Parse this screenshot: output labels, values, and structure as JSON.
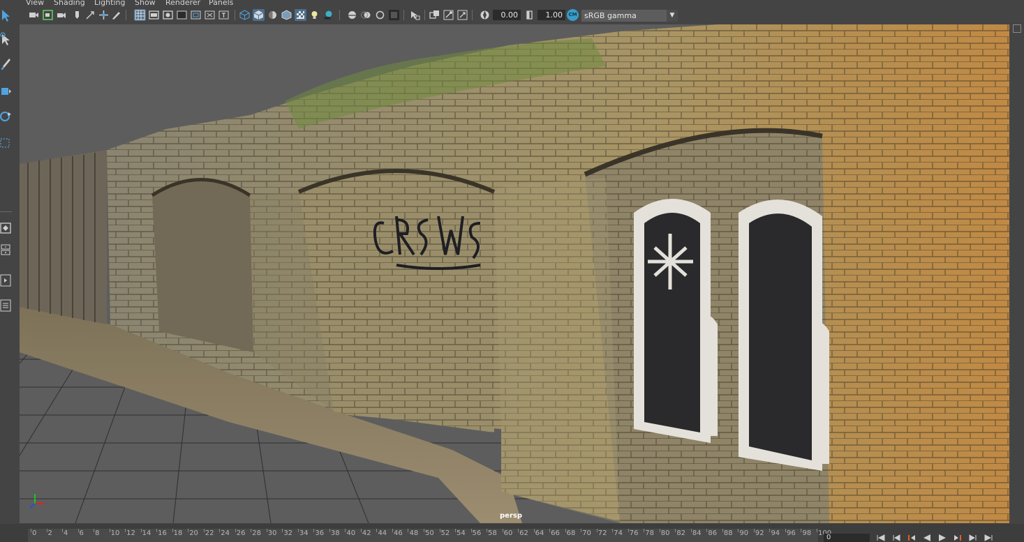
{
  "menu": [
    {
      "id": "view",
      "label": "View"
    },
    {
      "id": "shading",
      "label": "Shading"
    },
    {
      "id": "lighting",
      "label": "Lighting"
    },
    {
      "id": "show",
      "label": "Show"
    },
    {
      "id": "renderer",
      "label": "Renderer"
    },
    {
      "id": "panels",
      "label": "Panels"
    }
  ],
  "toolbar": {
    "exposure": "0.00",
    "gamma": "1.00",
    "color_space": "sRGB gamma",
    "cm_badge": "CM"
  },
  "viewport": {
    "camera": "persp",
    "axis_labels": {
      "x": "X",
      "y": "Y",
      "z": "Z"
    }
  },
  "timeline": {
    "ticks": [
      "0",
      "2",
      "4",
      "6",
      "8",
      "10",
      "12",
      "14",
      "16",
      "18",
      "20",
      "22",
      "24",
      "26",
      "28",
      "30",
      "32",
      "34",
      "36",
      "38",
      "40",
      "42",
      "44",
      "46",
      "48",
      "50",
      "52",
      "54",
      "56",
      "58",
      "60",
      "62",
      "64",
      "66",
      "68",
      "70",
      "72",
      "74",
      "76",
      "78",
      "80",
      "82",
      "84",
      "86",
      "88",
      "90",
      "92",
      "94",
      "96",
      "98",
      "100"
    ],
    "current_frame": "0"
  },
  "colors": {
    "accent": "#4e6e8c",
    "highlight": "#5fd35f"
  }
}
